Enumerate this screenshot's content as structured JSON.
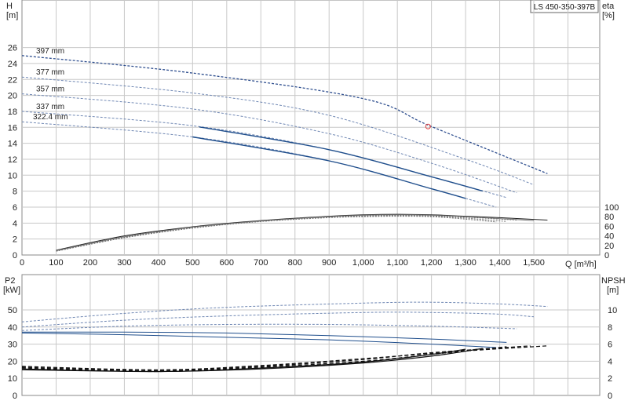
{
  "title_box": "LS 450-350-397B",
  "chart_data": [
    {
      "type": "line",
      "panel": "head-efficiency",
      "left_axis": {
        "label": "H",
        "unit": "[m]",
        "ticks": [
          0,
          2,
          4,
          6,
          8,
          10,
          12,
          14,
          16,
          18,
          20,
          22,
          24,
          26
        ],
        "ylim": [
          0,
          30
        ]
      },
      "right_axis": {
        "label": "eta",
        "unit": "[%]",
        "ticks": [
          0,
          20,
          40,
          60,
          80,
          100
        ]
      },
      "x_axis": {
        "label": "Q [m³/h]",
        "ticks": [
          "0",
          "100",
          "200",
          "300",
          "400",
          "500",
          "600",
          "700",
          "800",
          "900",
          "1,000",
          "1,100",
          "1,200",
          "1,300",
          "1,400",
          "1,500"
        ],
        "xlim": [
          0,
          1700
        ]
      },
      "grid": true,
      "head_series": [
        {
          "name": "397 mm",
          "values": [
            [
              0,
              25
            ],
            [
              500,
              22.8
            ],
            [
              1000,
              19.6
            ],
            [
              1200,
              16.1
            ],
            [
              1540,
              10.2
            ]
          ]
        },
        {
          "name": "377 mm",
          "values": [
            [
              0,
              22.3
            ],
            [
              500,
              20.3
            ],
            [
              900,
              17.5
            ],
            [
              1300,
              12.0
            ],
            [
              1500,
              8.8
            ]
          ]
        },
        {
          "name": "357 mm",
          "values": [
            [
              0,
              20.2
            ],
            [
              500,
              18.3
            ],
            [
              900,
              15.2
            ],
            [
              1200,
              11.5
            ],
            [
              1450,
              7.8
            ]
          ]
        },
        {
          "name": "337 mm",
          "values": [
            [
              0,
              18.0
            ],
            [
              500,
              16.2
            ],
            [
              900,
              13.2
            ],
            [
              1200,
              9.8
            ],
            [
              1420,
              7.2
            ]
          ]
        },
        {
          "name": "322.4 mm",
          "values": [
            [
              0,
              16.7
            ],
            [
              500,
              14.8
            ],
            [
              900,
              11.8
            ],
            [
              1200,
              8.3
            ],
            [
              1390,
              6.0
            ]
          ]
        }
      ],
      "efficiency_series": [
        {
          "values": [
            [
              100,
              10
            ],
            [
              300,
              40
            ],
            [
              500,
              59
            ],
            [
              700,
              72
            ],
            [
              900,
              81
            ],
            [
              1000,
              84
            ],
            [
              1100,
              85
            ],
            [
              1200,
              84
            ],
            [
              1300,
              81
            ],
            [
              1400,
              78
            ],
            [
              1540,
              73
            ]
          ]
        },
        {
          "values": [
            [
              100,
              9
            ],
            [
              300,
              38
            ],
            [
              500,
              58
            ],
            [
              700,
              71
            ],
            [
              900,
              80
            ],
            [
              1000,
              83
            ],
            [
              1100,
              84
            ],
            [
              1200,
              83
            ],
            [
              1300,
              80
            ],
            [
              1400,
              76
            ],
            [
              1500,
              72
            ]
          ]
        },
        {
          "values": [
            [
              100,
              9
            ],
            [
              300,
              37
            ],
            [
              500,
              57
            ],
            [
              700,
              71
            ],
            [
              900,
              80
            ],
            [
              1000,
              82
            ],
            [
              1100,
              83
            ],
            [
              1200,
              82
            ],
            [
              1300,
              79
            ],
            [
              1450,
              73
            ]
          ]
        },
        {
          "values": [
            [
              100,
              8
            ],
            [
              300,
              36
            ],
            [
              500,
              57
            ],
            [
              700,
              70
            ],
            [
              900,
              79
            ],
            [
              1000,
              81
            ],
            [
              1100,
              82
            ],
            [
              1200,
              81
            ],
            [
              1300,
              77
            ],
            [
              1420,
              70
            ]
          ]
        },
        {
          "values": [
            [
              100,
              8
            ],
            [
              300,
              36
            ],
            [
              500,
              56
            ],
            [
              700,
              70
            ],
            [
              900,
              78
            ],
            [
              1000,
              80
            ],
            [
              1100,
              81
            ],
            [
              1200,
              80
            ],
            [
              1300,
              75
            ],
            [
              1390,
              69
            ]
          ]
        }
      ],
      "operating_point": {
        "x": 1190,
        "y": 16.1
      }
    },
    {
      "type": "line",
      "panel": "power-npsh",
      "left_axis": {
        "label": "P2",
        "unit": "[kW]",
        "ticks": [
          0,
          10,
          20,
          30,
          40,
          50
        ],
        "ylim": [
          0,
          60
        ]
      },
      "right_axis": {
        "label": "NPSH",
        "unit": "[m]",
        "ticks": [
          0,
          2,
          4,
          6,
          8,
          10
        ]
      },
      "x_axis": {
        "xlim": [
          0,
          1700
        ]
      },
      "grid": true,
      "power_series": [
        {
          "values": [
            [
              0,
              43
            ],
            [
              300,
              48
            ],
            [
              600,
              51.5
            ],
            [
              1000,
              54
            ],
            [
              1200,
              54.5
            ],
            [
              1400,
              53.5
            ],
            [
              1540,
              52
            ]
          ]
        },
        {
          "values": [
            [
              0,
              40
            ],
            [
              300,
              44
            ],
            [
              600,
              46.5
            ],
            [
              1000,
              48.5
            ],
            [
              1200,
              48.5
            ],
            [
              1400,
              47.5
            ],
            [
              1500,
              46
            ]
          ]
        },
        {
          "values": [
            [
              0,
              38
            ],
            [
              300,
              40.5
            ],
            [
              600,
              41.5
            ],
            [
              900,
              41.5
            ],
            [
              1200,
              40.5
            ],
            [
              1450,
              39
            ]
          ]
        },
        {
          "values": [
            [
              0,
              37
            ],
            [
              300,
              37
            ],
            [
              600,
              36.5
            ],
            [
              900,
              35
            ],
            [
              1200,
              33
            ],
            [
              1420,
              31
            ]
          ]
        },
        {
          "values": [
            [
              0,
              36.5
            ],
            [
              300,
              35.5
            ],
            [
              600,
              34
            ],
            [
              900,
              32.5
            ],
            [
              1200,
              30
            ],
            [
              1390,
              28
            ]
          ]
        }
      ],
      "npsh_series": [
        {
          "values": [
            [
              0,
              3.0
            ],
            [
              400,
              2.8
            ],
            [
              700,
              3.1
            ],
            [
              1000,
              3.8
            ],
            [
              1200,
              4.6
            ],
            [
              1350,
              5.5
            ]
          ]
        },
        {
          "values": [
            [
              0,
              3.1
            ],
            [
              400,
              2.8
            ],
            [
              700,
              3.2
            ],
            [
              1000,
              3.9
            ],
            [
              1200,
              4.8
            ],
            [
              1300,
              5.4
            ]
          ]
        },
        {
          "values": [
            [
              0,
              3.2
            ],
            [
              400,
              2.8
            ],
            [
              700,
              3.3
            ],
            [
              1000,
              4.0
            ],
            [
              1200,
              4.8
            ],
            [
              1420,
              5.7
            ]
          ]
        },
        {
          "values": [
            [
              0,
              3.3
            ],
            [
              400,
              2.9
            ],
            [
              700,
              3.4
            ],
            [
              1000,
              4.2
            ],
            [
              1200,
              5.0
            ],
            [
              1490,
              5.8
            ]
          ]
        },
        {
          "values": [
            [
              0,
              3.4
            ],
            [
              400,
              3.0
            ],
            [
              700,
              3.5
            ],
            [
              1000,
              4.3
            ],
            [
              1300,
              5.2
            ],
            [
              1540,
              5.8
            ]
          ]
        }
      ]
    }
  ]
}
